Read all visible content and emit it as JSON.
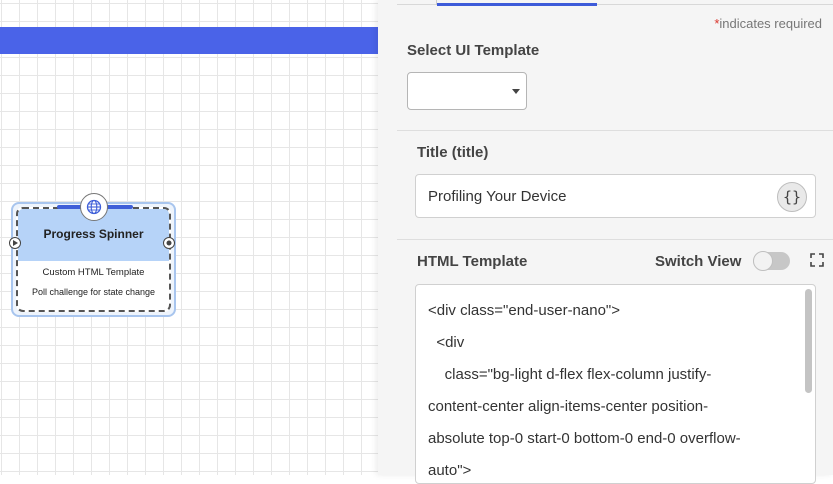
{
  "canvas": {
    "accent": "#4a63e8",
    "node": {
      "title": "Progress Spinner",
      "subtitle": "Custom HTML Template",
      "description": "Poll challenge for state change",
      "icon": "globe-icon",
      "header_color": "#b6d3f8"
    }
  },
  "panel": {
    "required_note": {
      "star": "*",
      "text": "indicates required"
    },
    "select_template": {
      "label": "Select UI Template",
      "value": ""
    },
    "title_field": {
      "label": "Title (title)",
      "value": "Profiling Your Device",
      "var_button": "{}"
    },
    "html_template": {
      "label": "HTML Template",
      "switch_view_label": "Switch View",
      "switch_on": false,
      "code_lines": [
        "<div class=\"end-user-nano\">",
        "  <div",
        "    class=\"bg-light d-flex flex-column justify-",
        "content-center align-items-center position-",
        "absolute top-0 start-0 bottom-0 end-0 overflow-",
        "auto\">"
      ]
    },
    "active_tab_color": "#3d5bd9"
  }
}
